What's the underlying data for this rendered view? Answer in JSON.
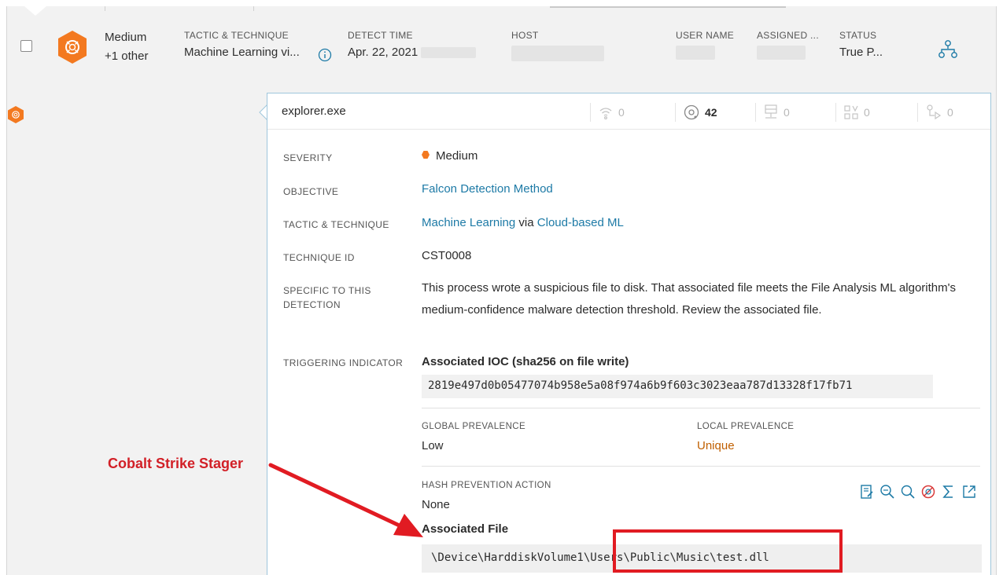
{
  "row": {
    "severity_main": "Medium",
    "severity_sub": "+1 other",
    "columns": [
      {
        "label": "TACTIC & TECHNIQUE",
        "value": "Machine Learning vi..."
      },
      {
        "label": "DETECT TIME",
        "value": "Apr. 22, 2021"
      },
      {
        "label": "HOST",
        "value": ""
      },
      {
        "label": "USER NAME",
        "value": ""
      },
      {
        "label": "ASSIGNED ...",
        "value": ""
      },
      {
        "label": "STATUS",
        "value": "True P..."
      }
    ]
  },
  "panel": {
    "process": "explorer.exe",
    "stats": [
      "0",
      "42",
      "0",
      "0",
      "0"
    ],
    "fields": {
      "severity_label": "SEVERITY",
      "severity_value": "Medium",
      "objective_label": "OBJECTIVE",
      "objective_value": "Falcon Detection Method",
      "tactic_label": "TACTIC & TECHNIQUE",
      "tactic_value_a": "Machine Learning",
      "tactic_via": "via",
      "tactic_value_b": "Cloud-based ML",
      "technique_id_label": "TECHNIQUE ID",
      "technique_id_value": "CST0008",
      "specific_label_1": "SPECIFIC TO THIS",
      "specific_label_2": "DETECTION",
      "specific_value": "This process wrote a suspicious file to disk. That associated file meets the File Analysis ML algorithm's medium-confidence malware detection threshold. Review the associated file.",
      "trigger_label": "TRIGGERING INDICATOR",
      "ioc_title": "Associated IOC (sha256 on file write)",
      "ioc_hash": "2819e497d0b05477074b958e5a08f974a6b9f603c3023eaa787d13328f17fb71",
      "global_prev_label": "GLOBAL PREVALENCE",
      "global_prev_value": "Low",
      "local_prev_label": "LOCAL PREVALENCE",
      "local_prev_value": "Unique",
      "hash_action_label": "HASH PREVENTION ACTION",
      "hash_action_value": "None",
      "assoc_file_title": "Associated File",
      "assoc_file_path": "\\Device\\HarddiskVolume1\\Users\\Public\\Music\\test.dll"
    }
  },
  "annotation": {
    "label": "Cobalt Strike Stager"
  },
  "colors": {
    "accent": "#1d7aa6",
    "severity": "#f37920",
    "annotation": "#e11b22"
  }
}
